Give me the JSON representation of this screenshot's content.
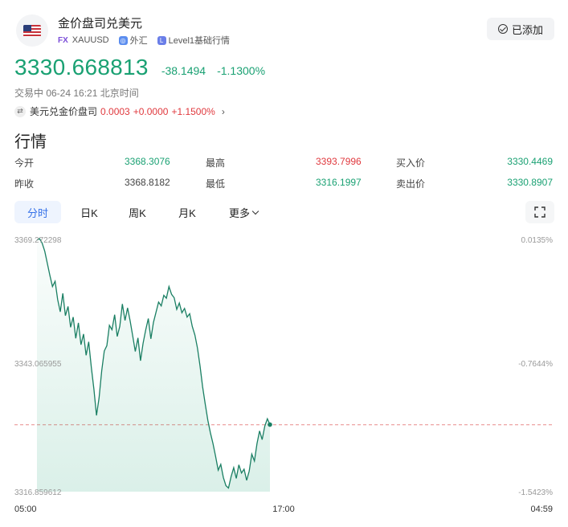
{
  "header": {
    "title": "金价盘司兑美元",
    "fx_badge": "FX",
    "symbol": "XAUUSD",
    "market": "外汇",
    "level": "Level1基础行情",
    "add_button": "已添加"
  },
  "quote": {
    "price": "3330.668813",
    "change": "-38.1494",
    "change_pct": "-1.1300%",
    "status": "交易中 06-24 16:21 北京时间"
  },
  "related": {
    "name": "美元兑金价盘司",
    "price": "0.0003",
    "change": "+0.0000",
    "change_pct": "+1.1500%"
  },
  "section_title": "行情",
  "stats": {
    "open_label": "今开",
    "open": "3368.3076",
    "high_label": "最高",
    "high": "3393.7996",
    "bid_label": "买入价",
    "bid": "3330.4469",
    "prev_label": "昨收",
    "prev": "3368.8182",
    "low_label": "最低",
    "low": "3316.1997",
    "ask_label": "卖出价",
    "ask": "3330.8907"
  },
  "tabs": [
    "分时",
    "日K",
    "周K",
    "月K",
    "更多"
  ],
  "colors": {
    "up": "#e0393e",
    "down": "#1aa173",
    "accent": "#3672e8"
  },
  "chart_data": {
    "type": "line",
    "x_start": "05:00",
    "x_mid": "17:00",
    "x_end": "04:59",
    "y_labels_left": [
      "3369.272298",
      "3343.065955",
      "3316.859612"
    ],
    "y_labels_right": [
      "0.0135%",
      "-0.7644%",
      "-1.5423%"
    ],
    "ylim": [
      3316.859612,
      3369.272298
    ],
    "ref_value": 3330.668813,
    "series": [
      {
        "values": [
          3368.8,
          3369.1,
          3368.2,
          3366.5,
          3364.0,
          3361.5,
          3359.2,
          3360.3,
          3356.5,
          3354.0,
          3357.8,
          3353.2,
          3355.1,
          3350.8,
          3352.9,
          3348.5,
          3351.7,
          3347.2,
          3349.4,
          3345.0,
          3347.8,
          3342.5,
          3338.0,
          3332.6,
          3336.2,
          3341.8,
          3345.9,
          3347.0,
          3351.2,
          3350.3,
          3353.4,
          3348.9,
          3351.0,
          3355.6,
          3352.2,
          3354.8,
          3352.1,
          3349.0,
          3345.8,
          3348.6,
          3343.9,
          3347.5,
          3350.2,
          3352.6,
          3348.4,
          3351.8,
          3353.9,
          3356.0,
          3355.2,
          3357.4,
          3356.8,
          3359.2,
          3357.6,
          3356.9,
          3354.5,
          3355.8,
          3353.8,
          3354.7,
          3352.9,
          3353.6,
          3351.0,
          3349.2,
          3346.5,
          3342.8,
          3338.5,
          3335.0,
          3331.6,
          3329.0,
          3326.8,
          3324.2,
          3321.3,
          3322.5,
          3319.8,
          3318.1,
          3317.6,
          3320.0,
          3321.8,
          3319.6,
          3322.4,
          3320.7,
          3321.5,
          3319.2,
          3321.1,
          3324.6,
          3323.2,
          3326.8,
          3329.4,
          3327.6,
          3330.4,
          3331.9,
          3330.7
        ]
      }
    ]
  }
}
